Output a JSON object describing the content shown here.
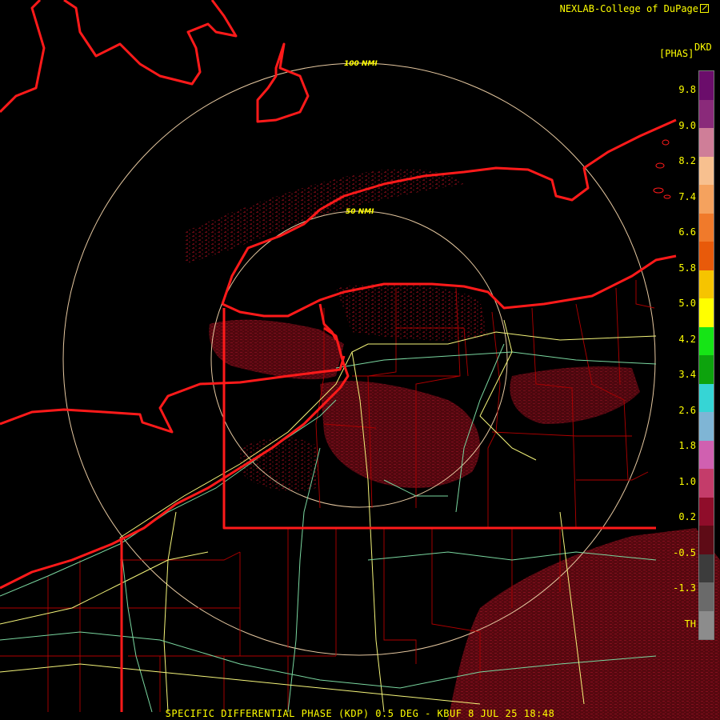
{
  "credit": "NEXLAB-College of DuPage",
  "credit_icon": "external-link-icon",
  "legend": {
    "unit_label": "[PHAS]",
    "product_label": "DKD",
    "ticks": [
      "9.8",
      "9.0",
      "8.2",
      "7.4",
      "6.6",
      "5.8",
      "5.0",
      "4.2",
      "3.4",
      "2.6",
      "1.8",
      "1.0",
      "0.2",
      "-0.5",
      "-1.3",
      "TH"
    ],
    "colors": [
      "#6b0d6b",
      "#8a2a7a",
      "#cf7e98",
      "#f7c08f",
      "#f5a25e",
      "#f07a2b",
      "#e85a0a",
      "#f6c400",
      "#ffff00",
      "#16e416",
      "#0da30d",
      "#36d5d5",
      "#7fb5d5",
      "#d060b0",
      "#c43c6a",
      "#8f0d2a",
      "#5e0b16",
      "#3c3c3c",
      "#6a6a6a",
      "#8c8c8c"
    ]
  },
  "range_rings": [
    {
      "label": "100 NMI"
    },
    {
      "label": "50 NMI"
    }
  ],
  "caption": "SPECIFIC DIFFERENTIAL PHASE (KDP) 0.5 DEG - KBUF 8 JUL 25 18:48",
  "colors": {
    "background": "#000000",
    "coastline": "#ff1a1a",
    "county_line": "#b00000",
    "ring": "#e6c8a0",
    "highway_yellow": "#f5f57a",
    "highway_green": "#7ad7a0",
    "echo_dark": "#6b0a14",
    "echo_mid": "#8a1020",
    "text": "#ffff00"
  }
}
